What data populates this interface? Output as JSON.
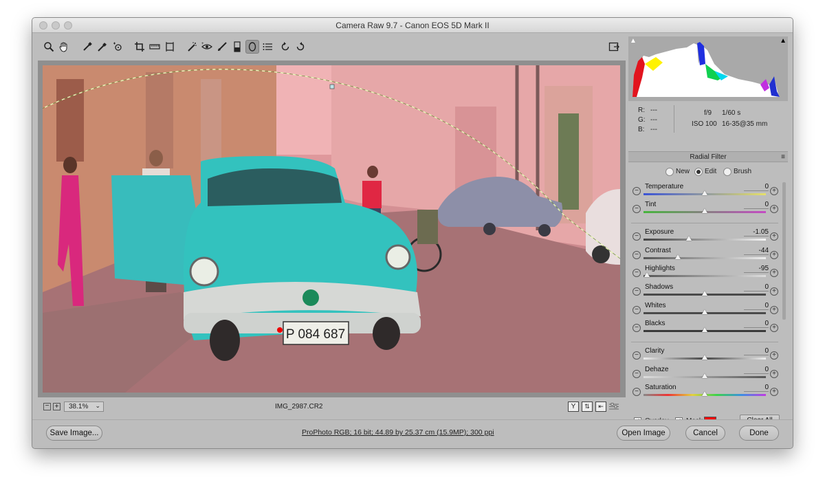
{
  "window": {
    "title": "Camera Raw 9.7  -  Canon EOS 5D Mark II"
  },
  "toolbar": {
    "tools": [
      "zoom-icon",
      "hand-icon",
      "white-balance-icon",
      "color-sampler-icon",
      "targeted-adjustment-icon",
      "crop-icon",
      "straighten-icon",
      "transform-icon",
      "spot-removal-icon",
      "red-eye-icon",
      "adjustment-brush-icon",
      "graduated-filter-icon",
      "radial-filter-icon",
      "preferences-icon",
      "rotate-left-icon",
      "rotate-right-icon"
    ]
  },
  "preview": {
    "plate": "P 084 687",
    "zoom": "38.1%",
    "filename": "IMG_2987.CR2"
  },
  "info": {
    "r_label": "R:",
    "g_label": "G:",
    "b_label": "B:",
    "r": "---",
    "g": "---",
    "b": "---",
    "aperture": "f/9",
    "shutter": "1/60 s",
    "iso": "ISO 100",
    "lens": "16-35@35 mm"
  },
  "panel": {
    "title": "Radial Filter",
    "modes": [
      {
        "label": "New",
        "selected": false
      },
      {
        "label": "Edit",
        "selected": true
      },
      {
        "label": "Brush",
        "selected": false
      }
    ],
    "sliders": [
      {
        "name": "Temperature",
        "value": "0",
        "position": 0.5
      },
      {
        "name": "Tint",
        "value": "0",
        "position": 0.5
      },
      {
        "name": "Exposure",
        "value": "-1.05",
        "position": 0.37
      },
      {
        "name": "Contrast",
        "value": "-44",
        "position": 0.28
      },
      {
        "name": "Highlights",
        "value": "-95",
        "position": 0.03
      },
      {
        "name": "Shadows",
        "value": "0",
        "position": 0.5
      },
      {
        "name": "Whites",
        "value": "0",
        "position": 0.5
      },
      {
        "name": "Blacks",
        "value": "0",
        "position": 0.5
      },
      {
        "name": "Clarity",
        "value": "0",
        "position": 0.5
      },
      {
        "name": "Dehaze",
        "value": "0",
        "position": 0.5
      },
      {
        "name": "Saturation",
        "value": "0",
        "position": 0.5
      }
    ],
    "overlay_label": "Overlay",
    "mask_label": "Mask",
    "mask_color": "#ff0000",
    "clear_all": "Clear All"
  },
  "footer": {
    "save_image": "Save Image...",
    "workflow": "ProPhoto RGB; 16 bit; 44.89 by 25.37 cm (15.9MP); 300 ppi",
    "open_image": "Open Image",
    "cancel": "Cancel",
    "done": "Done"
  }
}
